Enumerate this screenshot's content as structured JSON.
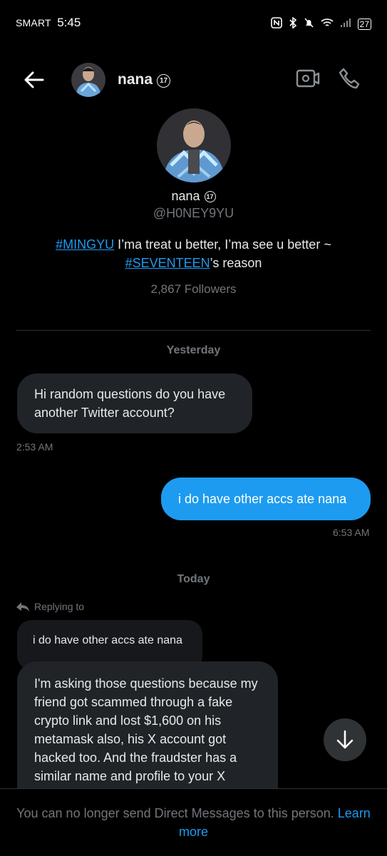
{
  "status_bar": {
    "carrier": "SMART",
    "time": "5:45",
    "battery": "27"
  },
  "header": {
    "name": "nana",
    "badge": "17"
  },
  "profile": {
    "name": "nana",
    "badge": "17",
    "handle": "@H0NEY9YU",
    "bio": {
      "tag1": "#MINGYU",
      "text1": " I’ma treat u better, I’ma see u better ~",
      "tag2": "#SEVENTEEN",
      "text2": "’s reason"
    },
    "followers": "2,867 Followers"
  },
  "conversation": {
    "day1": "Yesterday",
    "msg1": {
      "text": "Hi random questions do you have another Twitter account?",
      "time": "2:53 AM"
    },
    "msg2": {
      "text": "i do have other accs ate nana",
      "time": "6:53 AM"
    },
    "day2": "Today",
    "replying_label": "Replying to",
    "quoted": "i do have other accs ate nana",
    "msg3": {
      "text": "I'm asking those questions because my friend got scammed through a fake crypto link and lost $1,600 on his metamask also, his X account got hacked too. And the fraudster has a similar name and profile to your X account we made a huge mistake by"
    }
  },
  "footer": {
    "text": "You can no longer send Direct Messages to this person.",
    "link": "Learn more"
  },
  "icons": [
    "back-arrow-icon",
    "video-icon",
    "phone-icon",
    "reply-arrow-icon",
    "arrow-down-icon"
  ]
}
